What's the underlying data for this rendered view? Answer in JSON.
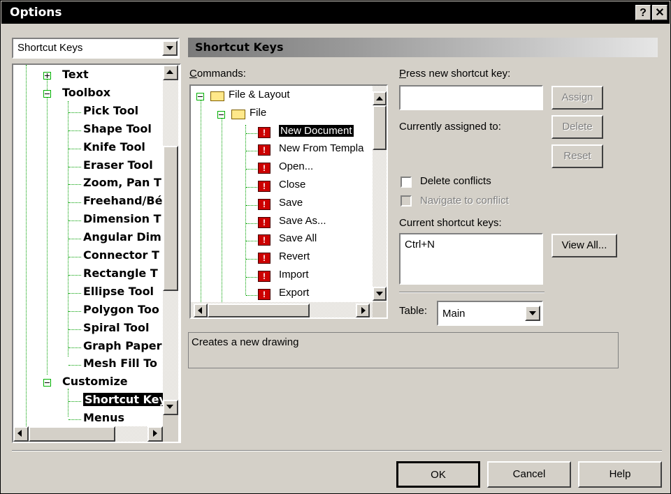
{
  "window": {
    "title": "Options",
    "help_glyph": "?",
    "close_glyph": "✕"
  },
  "category_combo": {
    "value": "Shortcut Keys"
  },
  "header": {
    "title": "Shortcut Keys"
  },
  "tree": {
    "items": [
      {
        "label": "Text",
        "expander": "plus"
      },
      {
        "label": "Toolbox",
        "expander": "minus"
      },
      {
        "label": "Pick Tool"
      },
      {
        "label": "Shape Tool"
      },
      {
        "label": "Knife Tool"
      },
      {
        "label": "Eraser Tool"
      },
      {
        "label": "Zoom, Pan T"
      },
      {
        "label": "Freehand/Bé"
      },
      {
        "label": "Dimension T"
      },
      {
        "label": "Angular Dim"
      },
      {
        "label": "Connector T"
      },
      {
        "label": "Rectangle T"
      },
      {
        "label": "Ellipse Tool"
      },
      {
        "label": "Polygon Too"
      },
      {
        "label": "Spiral Tool"
      },
      {
        "label": "Graph Paper"
      },
      {
        "label": "Mesh Fill To"
      },
      {
        "label": "Customize",
        "expander": "minus"
      },
      {
        "label": "Shortcut Key",
        "selected": true
      },
      {
        "label": "Menus"
      }
    ]
  },
  "commands": {
    "label": "Commands:",
    "items": [
      {
        "label": "File & Layout",
        "kind": "folder"
      },
      {
        "label": "File",
        "kind": "folder"
      },
      {
        "label": "New Document",
        "selected": true
      },
      {
        "label": "New From Templa"
      },
      {
        "label": "Open..."
      },
      {
        "label": "Close"
      },
      {
        "label": "Save"
      },
      {
        "label": "Save As..."
      },
      {
        "label": "Save All"
      },
      {
        "label": "Revert"
      },
      {
        "label": "Import"
      },
      {
        "label": "Export"
      }
    ]
  },
  "shortcut": {
    "press_label": "Press new shortcut key:",
    "press_value": "",
    "assigned_label": "Currently assigned to:",
    "assign_button": "Assign",
    "delete_button": "Delete",
    "reset_button": "Reset",
    "delete_conflicts": "Delete conflicts",
    "navigate_conflict": "Navigate to conflict",
    "current_label": "Current shortcut keys:",
    "current_value": "Ctrl+N",
    "view_all_button": "View All...",
    "table_label": "Table:",
    "table_value": "Main"
  },
  "description": "Creates a new drawing",
  "footer": {
    "ok": "OK",
    "cancel": "Cancel",
    "help": "Help"
  }
}
